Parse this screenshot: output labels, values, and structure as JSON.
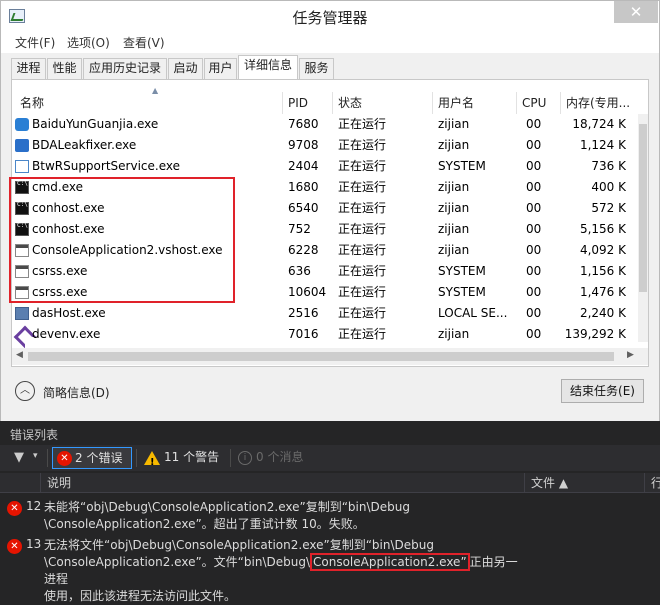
{
  "task_manager": {
    "title": "任务管理器",
    "menu": [
      "文件(F)",
      "选项(O)",
      "查看(V)"
    ],
    "tabs": [
      "进程",
      "性能",
      "应用历史记录",
      "启动",
      "用户",
      "详细信息",
      "服务"
    ],
    "active_tab": "详细信息",
    "columns": [
      "名称",
      "PID",
      "状态",
      "用户名",
      "CPU",
      "内存(专用..."
    ],
    "processes": [
      {
        "icon": "baidu-icon",
        "name": "BaiduYunGuanjia.exe",
        "pid": "7680",
        "status": "正在运行",
        "user": "zijian",
        "cpu": "00",
        "mem": "18,724 K"
      },
      {
        "icon": "bda-icon",
        "name": "BDALeakfixer.exe",
        "pid": "9708",
        "status": "正在运行",
        "user": "zijian",
        "cpu": "00",
        "mem": "1,124 K"
      },
      {
        "icon": "service-window-icon",
        "name": "BtwRSupportService.exe",
        "pid": "2404",
        "status": "正在运行",
        "user": "SYSTEM",
        "cpu": "00",
        "mem": "736 K"
      },
      {
        "icon": "cmd-icon",
        "name": "cmd.exe",
        "pid": "1680",
        "status": "正在运行",
        "user": "zijian",
        "cpu": "00",
        "mem": "400 K"
      },
      {
        "icon": "cmd-icon",
        "name": "conhost.exe",
        "pid": "6540",
        "status": "正在运行",
        "user": "zijian",
        "cpu": "00",
        "mem": "572 K"
      },
      {
        "icon": "cmd-icon",
        "name": "conhost.exe",
        "pid": "752",
        "status": "正在运行",
        "user": "zijian",
        "cpu": "00",
        "mem": "5,156 K"
      },
      {
        "icon": "app-window-icon",
        "name": "ConsoleApplication2.vshost.exe",
        "pid": "6228",
        "status": "正在运行",
        "user": "zijian",
        "cpu": "00",
        "mem": "4,092 K"
      },
      {
        "icon": "app-window-icon",
        "name": "csrss.exe",
        "pid": "636",
        "status": "正在运行",
        "user": "SYSTEM",
        "cpu": "00",
        "mem": "1,156 K"
      },
      {
        "icon": "app-window-icon",
        "name": "csrss.exe",
        "pid": "10604",
        "status": "正在运行",
        "user": "SYSTEM",
        "cpu": "00",
        "mem": "1,476 K"
      },
      {
        "icon": "dashost-icon",
        "name": "dasHost.exe",
        "pid": "2516",
        "status": "正在运行",
        "user": "LOCAL SE...",
        "cpu": "00",
        "mem": "2,240 K"
      },
      {
        "icon": "visual-studio-icon",
        "name": "devenv.exe",
        "pid": "7016",
        "status": "正在运行",
        "user": "zijian",
        "cpu": "00",
        "mem": "139,292 K"
      }
    ],
    "fewer_details": "简略信息(D)",
    "end_task": "结束任务(E)"
  },
  "error_list": {
    "title": "错误列表",
    "errors_btn": "2 个错误",
    "warnings_btn": "11 个警告",
    "messages_btn": "0 个消息",
    "columns": [
      "说明",
      "文件 ▲",
      "行"
    ],
    "errors": [
      {
        "num": "12",
        "text": "未能将“obj\\Debug\\ConsoleApplication2.exe”复制到“bin\\Debug\n\\ConsoleApplication2.exe”。超出了重试计数 10。失败。"
      },
      {
        "num": "13",
        "text_pre": "无法将文件“obj\\Debug\\ConsoleApplication2.exe”复制到“bin\\Debug\n\\ConsoleApplication2.exe”。文件“bin\\Debug\\",
        "text_hl": "ConsoleApplication2.exe”",
        "text_post": "正由另一进程\n使用，因此该进程无法访问此文件。"
      }
    ]
  },
  "colors": {
    "highlight_red": "#e0222a",
    "error_red": "#e51400",
    "warning_yellow": "#f7b900",
    "vs_dark": "#252526"
  }
}
